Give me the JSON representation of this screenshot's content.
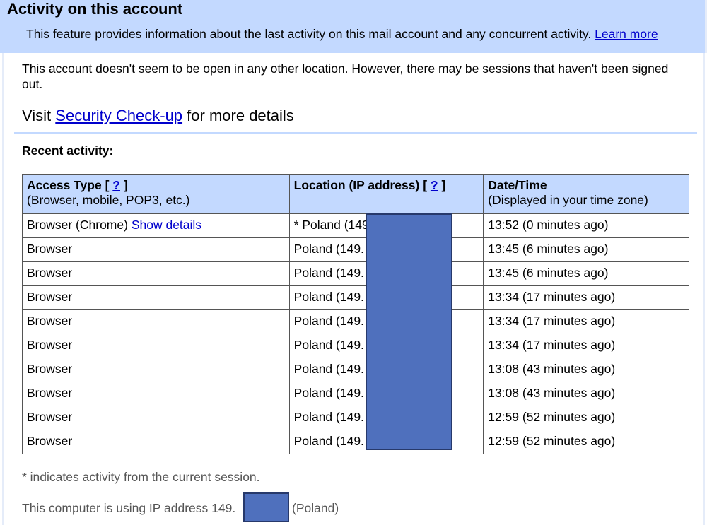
{
  "header": {
    "title": "Activity on this account",
    "intro": "This feature provides information about the last activity on this mail account and any concurrent activity.",
    "learn_more": "Learn more"
  },
  "status": {
    "message": "This account doesn't seem to be open in any other location. However, there may be sessions that haven't been signed out.",
    "visit_prefix": "Visit",
    "security_link": "Security Check-up",
    "visit_suffix": "for more details"
  },
  "recent": {
    "heading": "Recent activity:",
    "columns": [
      {
        "title": "Access Type",
        "help": "?",
        "subtitle": "(Browser, mobile, POP3, etc.)"
      },
      {
        "title": "Location (IP address)",
        "help": "?",
        "subtitle": ""
      },
      {
        "title": "Date/Time",
        "help": "",
        "subtitle": "(Displayed in your time zone)"
      }
    ],
    "rows": [
      {
        "access": "Browser (Chrome)",
        "details": "Show details",
        "location": "* Poland (149.",
        "time": "13:52 (0 minutes ago)"
      },
      {
        "access": "Browser",
        "details": "",
        "location": "Poland (149.",
        "time": "13:45 (6 minutes ago)"
      },
      {
        "access": "Browser",
        "details": "",
        "location": "Poland (149.",
        "time": "13:45 (6 minutes ago)"
      },
      {
        "access": "Browser",
        "details": "",
        "location": "Poland (149.",
        "time": "13:34 (17 minutes ago)"
      },
      {
        "access": "Browser",
        "details": "",
        "location": "Poland (149.",
        "time": "13:34 (17 minutes ago)"
      },
      {
        "access": "Browser",
        "details": "",
        "location": "Poland (149.",
        "time": "13:34 (17 minutes ago)"
      },
      {
        "access": "Browser",
        "details": "",
        "location": "Poland (149.",
        "time": "13:08 (43 minutes ago)"
      },
      {
        "access": "Browser",
        "details": "",
        "location": "Poland (149.",
        "time": "13:08 (43 minutes ago)"
      },
      {
        "access": "Browser",
        "details": "",
        "location": "Poland (149.",
        "time": "12:59 (52 minutes ago)"
      },
      {
        "access": "Browser",
        "details": "",
        "location": "Poland (149.",
        "time": "12:59 (52 minutes ago)"
      }
    ]
  },
  "footer": {
    "note": "* indicates activity from the current session.",
    "ip_prefix": "This computer is using IP address 149.",
    "ip_country": "(Poland)"
  },
  "colors": {
    "header_bg": "#c3d9ff",
    "link": "#0000cc",
    "redaction": "#4f70bd"
  }
}
